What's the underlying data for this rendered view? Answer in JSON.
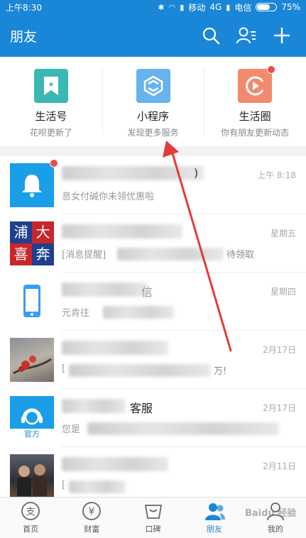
{
  "status_bar": {
    "time": "上午8:30",
    "carrier1": "移动",
    "network": "4G",
    "carrier2": "电信",
    "battery": "75%",
    "battery_level": 0.75
  },
  "header": {
    "title": "朋友",
    "icons": [
      "search-icon",
      "contacts-icon",
      "add-icon"
    ]
  },
  "quick_entries": [
    {
      "label": "生活号",
      "subtitle": "花呗更新了",
      "icon": "bookmark-icon",
      "color": "#3bb8b3",
      "badge": false
    },
    {
      "label": "小程序",
      "subtitle": "发现更多服务",
      "icon": "mini-program-icon",
      "color": "#67b3ee",
      "badge": false
    },
    {
      "label": "生活圈",
      "subtitle": "你有朋友更新动态",
      "icon": "life-circle-icon",
      "color": "#f28a6e",
      "badge": true
    }
  ],
  "conversations": [
    {
      "name": "",
      "message": "息女付碱你未领优惠啦",
      "time": "上午 8:18",
      "avatar": "bell-icon",
      "badge": true
    },
    {
      "name": "",
      "message": "[消息提醒]",
      "message_tail": "待领取",
      "time": "星期五",
      "avatar": "shop-avatar",
      "badge": false
    },
    {
      "name": "",
      "message": "元肯往",
      "time": "星期四",
      "avatar": "phone-icon",
      "badge": false
    },
    {
      "name": "",
      "message": "[",
      "message_tail": "万!",
      "time": "2月17日",
      "avatar": "flower-photo",
      "badge": false
    },
    {
      "name": "",
      "name_tail": "客服",
      "message": "您是",
      "time": "2月17日",
      "avatar": "customer-service-icon",
      "avatar_label": "官方",
      "badge": false
    },
    {
      "name": "",
      "message": "[",
      "time": "2月11日",
      "avatar": "people-photo",
      "badge": false
    }
  ],
  "tabs": [
    {
      "label": "首页",
      "icon": "alipay-icon",
      "active": false
    },
    {
      "label": "财富",
      "icon": "wealth-icon",
      "active": false
    },
    {
      "label": "口碑",
      "icon": "koubei-icon",
      "active": false
    },
    {
      "label": "朋友",
      "icon": "friends-icon",
      "active": true
    },
    {
      "label": "我的",
      "icon": "profile-icon",
      "active": false
    }
  ],
  "colors": {
    "brand": "#1a86d8",
    "badge_red": "#f04a4a",
    "arrow_red": "#e23b3b"
  },
  "watermark": "Baidu 经验"
}
